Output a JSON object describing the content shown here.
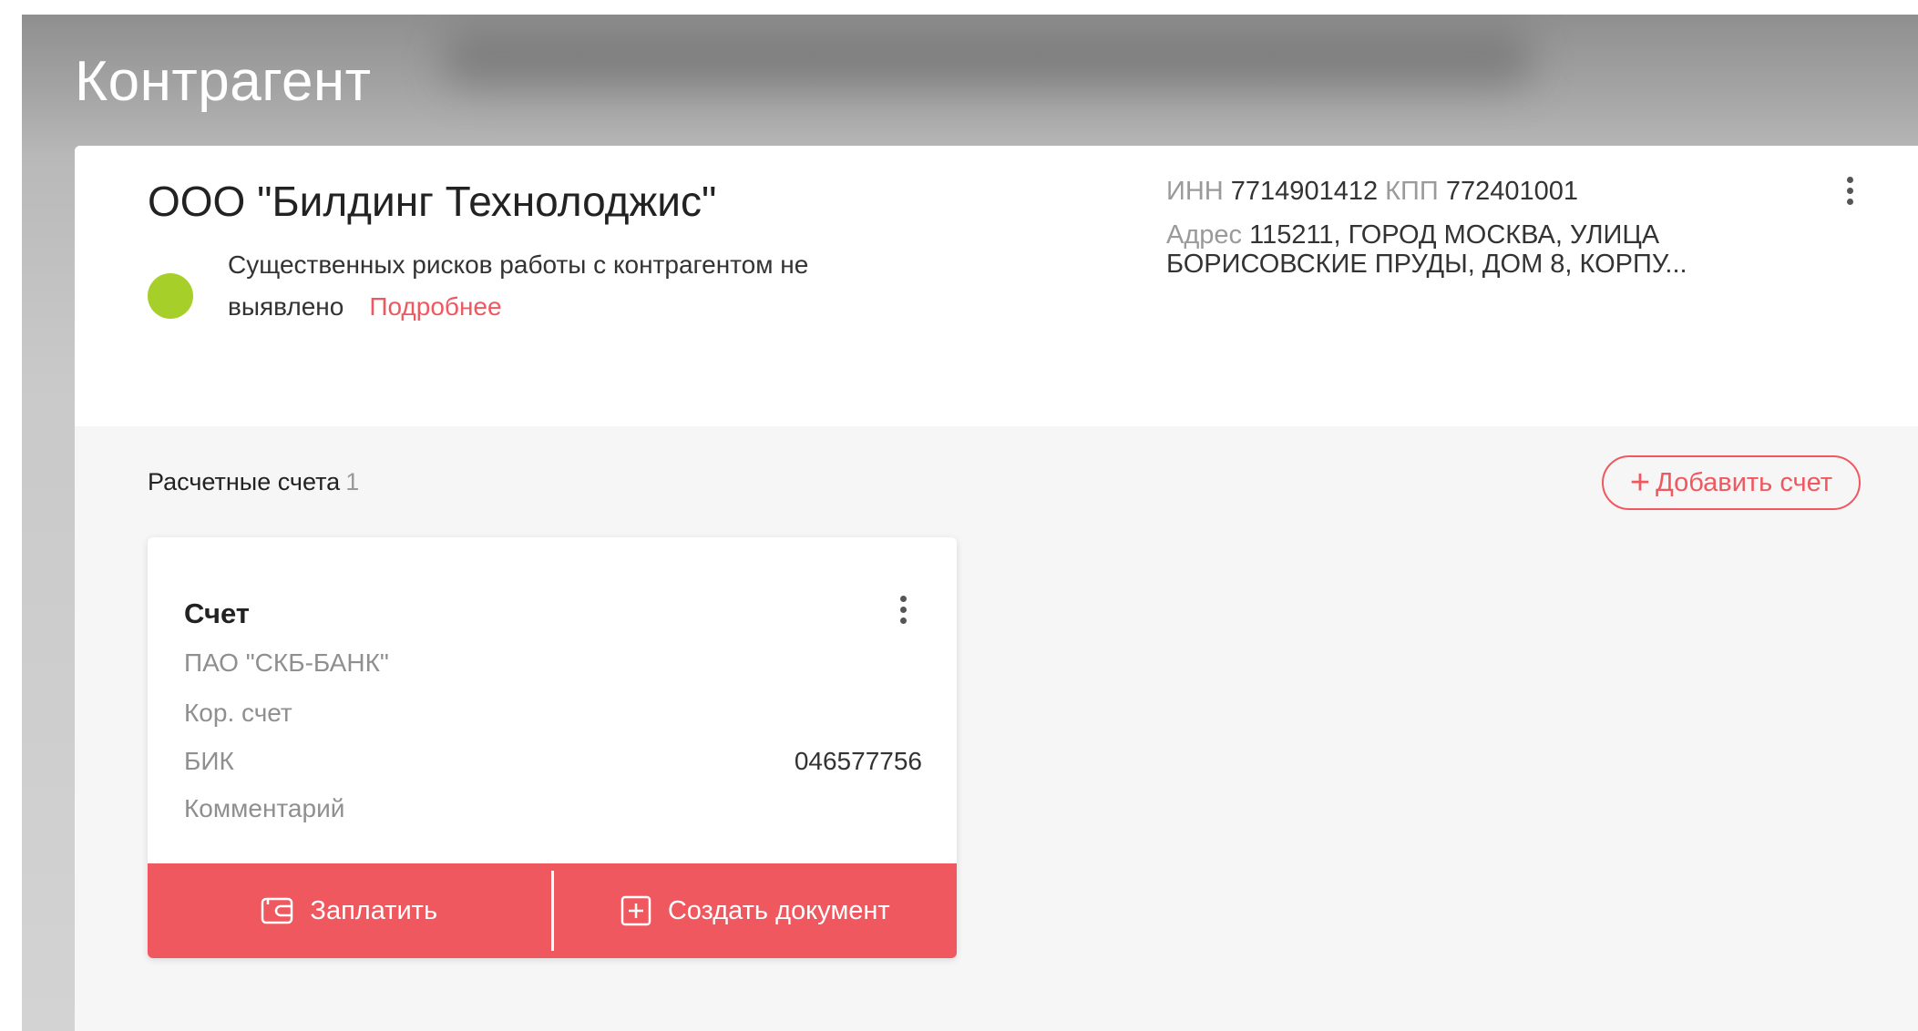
{
  "page": {
    "title": "Контрагент"
  },
  "counterparty": {
    "name": "ООО \"Билдинг Технолоджис\"",
    "risk": {
      "text": "Существенных рисков работы с контрагентом не выявлено",
      "link": "Подробнее",
      "status_color": "#a6cf2a"
    },
    "inn_label": "ИНН",
    "inn": "7714901412",
    "kpp_label": "КПП",
    "kpp": "772401001",
    "address_label": "Адрес",
    "address": "115211, ГОРОД МОСКВА, УЛИЦА БОРИСОВСКИЕ ПРУДЫ, ДОМ 8, КОРПУ..."
  },
  "accounts": {
    "title": "Расчетные счета",
    "count": "1",
    "add_label": "Добавить счет",
    "card": {
      "title": "Счет",
      "bank": "ПАО \"СКБ-БАНК\"",
      "kor_label": "Кор. счет",
      "kor_value": "",
      "bik_label": "БИК",
      "bik_value": "046577756",
      "comment_label": "Комментарий",
      "comment_value": "",
      "pay_label": "Заплатить",
      "create_doc_label": "Создать документ"
    }
  },
  "colors": {
    "accent": "#f0585f",
    "risk_ok": "#a6cf2a"
  },
  "icons": [
    "more-vertical-icon",
    "plus-icon",
    "wallet-icon",
    "add-document-icon"
  ]
}
